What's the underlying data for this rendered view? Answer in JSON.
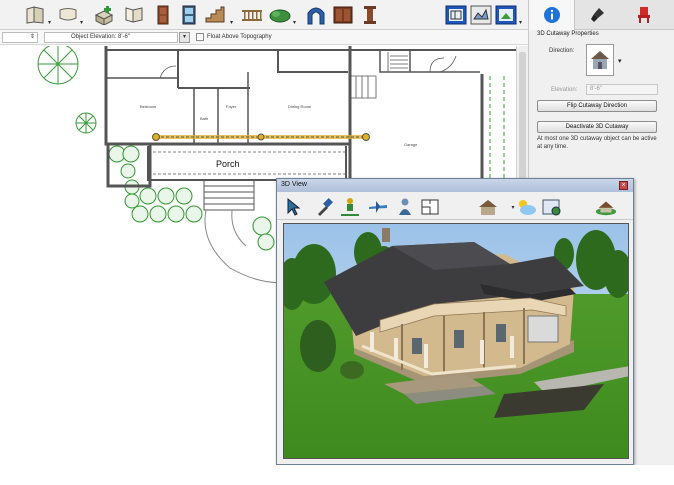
{
  "toolbar": {
    "icons": [
      "wall-tool-icon",
      "cabinet-tool-icon",
      "stair-tool-icon",
      "window-tool-icon",
      "door-tool-icon",
      "window-pane-icon",
      "steps-icon",
      "railing-icon",
      "shrub-icon",
      "arch-icon",
      "cabinet-door-icon",
      "column-icon",
      "view-plan-icon",
      "view-elevation-icon",
      "view-3d-icon"
    ]
  },
  "optionsbar": {
    "spinner_value": "",
    "elevation_field": "Object Elevation: 8'-6\"",
    "float_label": "Float Above Topography"
  },
  "plan": {
    "porch_label": "Porch",
    "room_labels": [
      "Bedroom",
      "Foyer",
      "Dining Room",
      "Garage",
      "Bath"
    ]
  },
  "right_panel": {
    "tabs": [
      "info-tab",
      "paint-tab",
      "chair-tab"
    ],
    "header": "3D Cutaway Properties",
    "direction_label": "Direction:",
    "elevation_label": "Elevation:",
    "elevation_value": "8'-6\"",
    "flip_button": "Flip Cutaway Direction",
    "deactivate_button": "Deactivate 3D Cutaway",
    "note": "At most one 3D cutaway object can be active at any time."
  },
  "window3d": {
    "title": "3D View",
    "close_label": "×"
  },
  "colors": {
    "accent_blue": "#1e72d9",
    "plant_green": "#3d9b3d",
    "wall_gray": "#555555",
    "cutaway_line": "#e0b020",
    "grass": "#4a9c2a"
  }
}
